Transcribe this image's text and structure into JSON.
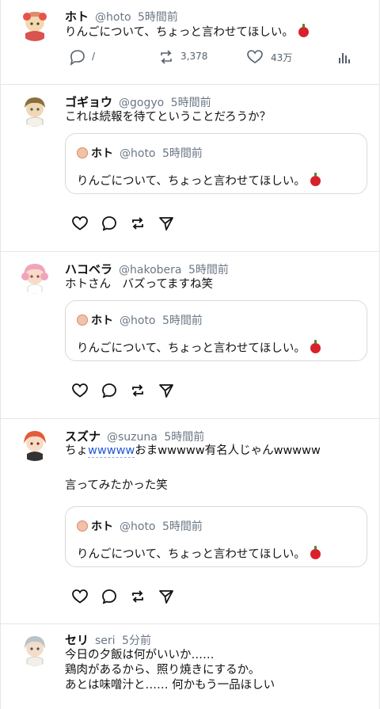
{
  "posts": [
    {
      "name": "ホト",
      "handle": "@hoto",
      "time": "5時間前",
      "text": "りんごについて、ちょっと言わせてほしい。",
      "reply_count": "/",
      "retweet_count": "3,378",
      "like_count": "43万"
    },
    {
      "name": "ゴギョウ",
      "handle": "@gogyo",
      "time": "5時間前",
      "text": "これは続報を待てということだろうか？",
      "quote": {
        "name": "ホト",
        "handle": "@hoto",
        "time": "5時間前",
        "text": "りんごについて、ちょっと言わせてほしい。"
      }
    },
    {
      "name": "ハコベラ",
      "handle": "@hakobera",
      "time": "5時間前",
      "text": "ホトさん　バズってますね笑",
      "quote": {
        "name": "ホト",
        "handle": "@hoto",
        "time": "5時間前",
        "text": "りんごについて、ちょっと言わせてほしい。"
      }
    },
    {
      "name": "スズナ",
      "handle": "@suzuna",
      "time": "5時間前",
      "text_pre": "ちょ",
      "text_link": "wwwww",
      "text_post": "おまwwwww有名人じゃんwwwww",
      "text2": "言ってみたかった笑",
      "quote": {
        "name": "ホト",
        "handle": "@hoto",
        "time": "5時間前",
        "text": "りんごについて、ちょっと言わせてほしい。"
      }
    },
    {
      "name": "セリ",
      "handle": "seri",
      "time": "5分前",
      "lines": [
        "今日の夕飯は何がいいか……",
        "鶏肉があるから、照り焼きにするか。",
        "あとは味噌汁と……  何かもう一品ほしい"
      ]
    }
  ],
  "colors": {
    "handle": "#6b7785",
    "link": "#2458d9",
    "divider": "#e6e6e6",
    "apple": "#d9212b"
  },
  "icons": [
    "reply-icon",
    "retweet-icon",
    "like-icon",
    "stats-icon",
    "heart-icon",
    "bubble-icon",
    "repeat-icon",
    "send-icon",
    "apple-emoji"
  ]
}
